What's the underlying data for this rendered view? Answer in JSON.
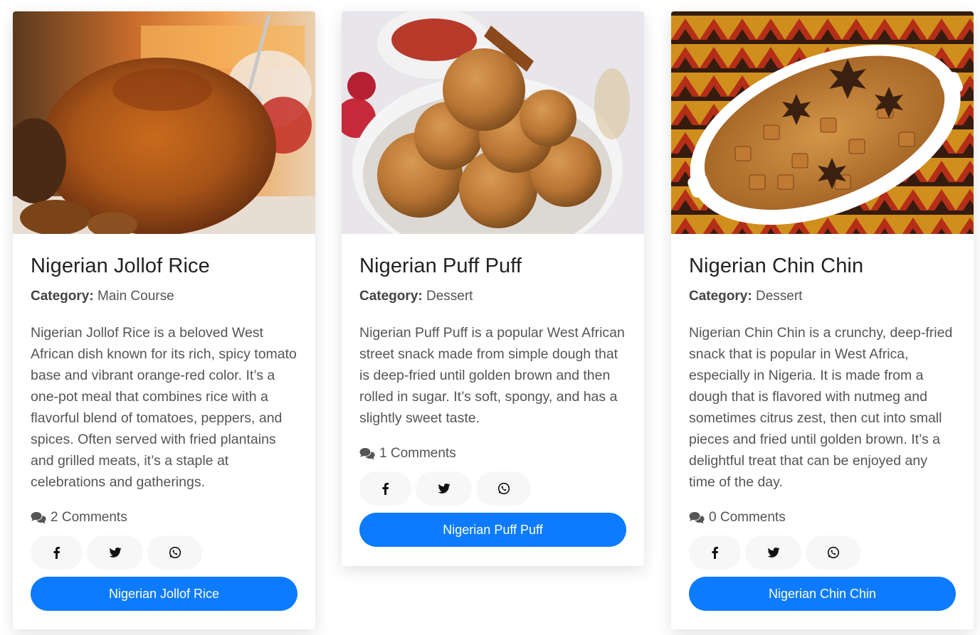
{
  "cards": [
    {
      "title": "Nigerian Jollof Rice",
      "category_label": "Category:",
      "category_value": "Main Course",
      "description": "Nigerian Jollof Rice is a beloved West African dish known for its rich, spicy tomato base and vibrant orange-red color. It’s a one-pot meal that combines rice with a flavorful blend of tomatoes, peppers, and spices. Often served with fried plantains and grilled meats, it’s a staple at celebrations and gatherings.",
      "comments": "2 Comments",
      "button_label": "Nigerian Jollof Rice"
    },
    {
      "title": "Nigerian Puff Puff",
      "category_label": "Category:",
      "category_value": "Dessert",
      "description": "Nigerian Puff Puff is a popular West African street snack made from simple dough that is deep-fried until golden brown and then rolled in sugar. It’s soft, spongy, and has a slightly sweet taste.",
      "comments": "1 Comments",
      "button_label": "Nigerian Puff Puff"
    },
    {
      "title": "Nigerian Chin Chin",
      "category_label": "Category:",
      "category_value": "Dessert",
      "description": "Nigerian Chin Chin is a crunchy, deep-fried snack that is popular in West Africa, especially in Nigeria. It is made from a dough that is flavored with nutmeg and sometimes citrus zest, then cut into small pieces and fried until golden brown. It’s a delightful treat that can be enjoyed any time of the day.",
      "comments": "0 Comments",
      "button_label": "Nigerian Chin Chin"
    }
  ],
  "icons": {
    "comments": "comments-icon",
    "facebook": "facebook-icon",
    "twitter": "twitter-icon",
    "whatsapp": "whatsapp-icon"
  },
  "colors": {
    "button": "#0d7bff",
    "share_bg": "#f7f7f7"
  }
}
